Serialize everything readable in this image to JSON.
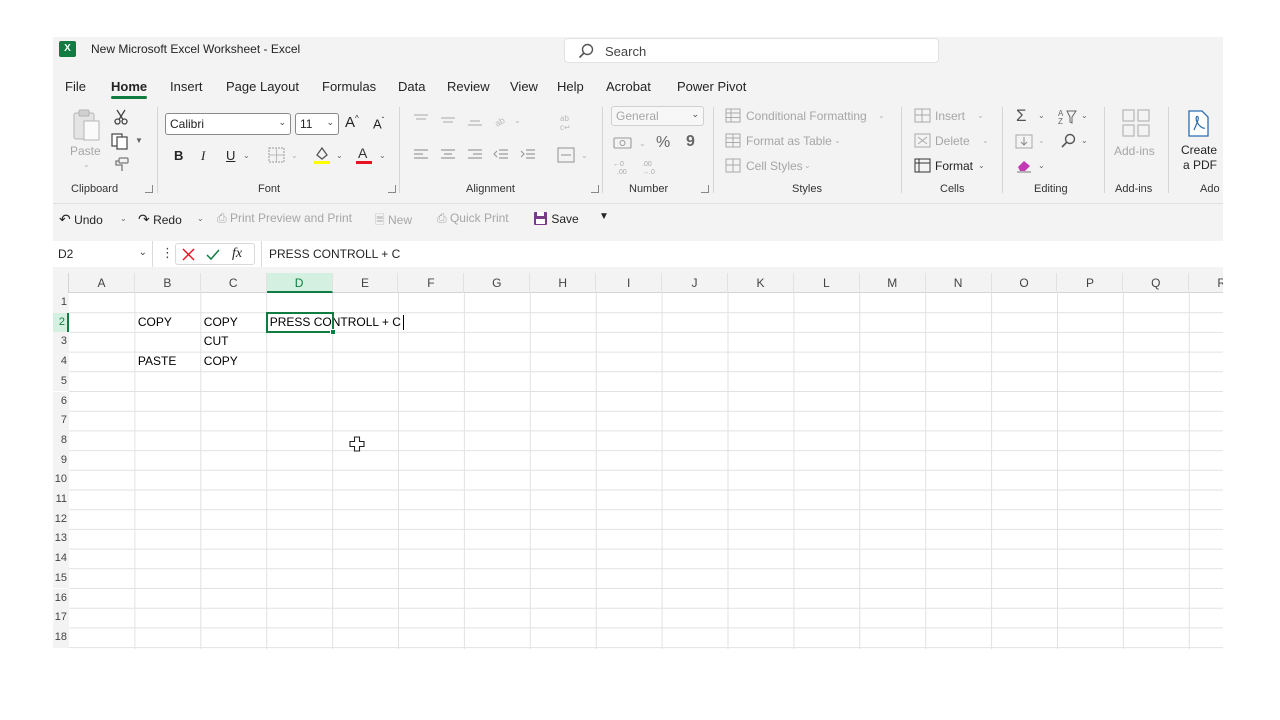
{
  "window": {
    "title": "New Microsoft Excel Worksheet  -  Excel",
    "logo_letter": "X",
    "search_placeholder": "Search"
  },
  "menu_tabs": [
    "File",
    "Home",
    "Insert",
    "Page Layout",
    "Formulas",
    "Data",
    "Review",
    "View",
    "Help",
    "Acrobat",
    "Power Pivot"
  ],
  "active_tab": "Home",
  "ribbon": {
    "clipboard": {
      "label": "Clipboard",
      "paste": "Paste"
    },
    "font": {
      "label": "Font",
      "family": "Calibri",
      "size": "11",
      "bold": "B",
      "italic": "I",
      "underline": "U"
    },
    "alignment": {
      "label": "Alignment"
    },
    "number": {
      "label": "Number",
      "format": "General",
      "percent": "%",
      "comma": "9"
    },
    "styles": {
      "label": "Styles",
      "conditional": "Conditional Formatting",
      "format_table": "Format as Table",
      "cell_styles": "Cell Styles"
    },
    "cells": {
      "label": "Cells",
      "insert": "Insert",
      "delete": "Delete",
      "format": "Format"
    },
    "editing": {
      "label": "Editing"
    },
    "addins": {
      "label": "Add-ins",
      "button": "Add-ins"
    },
    "acrobat": {
      "label": "Ado",
      "create_line1": "Create",
      "create_line2": "a PDF"
    }
  },
  "quick_access": {
    "undo": "Undo",
    "redo": "Redo",
    "print_preview": "Print Preview and Print",
    "new": "New",
    "quick_print": "Quick Print",
    "save": "Save"
  },
  "formula_bar": {
    "name_box": "D2",
    "fx": "fx",
    "content": "PRESS CONTROLL + C"
  },
  "grid": {
    "columns": [
      "A",
      "B",
      "C",
      "D",
      "E",
      "F",
      "G",
      "H",
      "I",
      "J",
      "K",
      "L",
      "M",
      "N",
      "O",
      "P",
      "Q",
      "R"
    ],
    "rows": [
      "1",
      "2",
      "3",
      "4",
      "5",
      "6",
      "7",
      "8",
      "9",
      "10",
      "11",
      "12",
      "13",
      "14",
      "15",
      "16",
      "17",
      "18"
    ],
    "selected_column": "D",
    "selected_row": "2",
    "cells": [
      {
        "ref": "B2",
        "value": "COPY"
      },
      {
        "ref": "C2",
        "value": "COPY"
      },
      {
        "ref": "D2",
        "value": "PRESS CONTROLL + C"
      },
      {
        "ref": "C3",
        "value": "CUT"
      },
      {
        "ref": "B4",
        "value": "PASTE"
      },
      {
        "ref": "C4",
        "value": "COPY"
      }
    ]
  },
  "colors": {
    "accent": "#107c41",
    "font_color_bar": "#e81123",
    "highlight_bar": "#ffff00",
    "cancel_x": "#e81123"
  }
}
